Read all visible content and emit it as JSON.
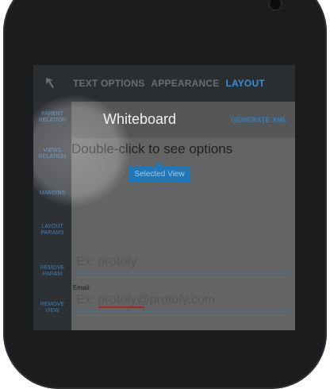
{
  "tabs": [
    {
      "label": "TEXT OPTIONS",
      "active": false
    },
    {
      "label": "APPEARANCE",
      "active": false
    },
    {
      "label": "LAYOUT",
      "active": true
    }
  ],
  "sidebar": {
    "items": [
      {
        "label": "PARENT RELATION"
      },
      {
        "label": "VIEWS RELATION"
      },
      {
        "label": "MARGINS"
      },
      {
        "label": "LAYOUT PARAMS"
      },
      {
        "label": "REMOVE PARAM"
      },
      {
        "label": "REMOVE VIEW"
      }
    ]
  },
  "header": {
    "title": "Whiteboard",
    "generate_xml": "GENERATE XML"
  },
  "canvas": {
    "hint": "Double-click to see options",
    "selected_view": "Selected View",
    "field1_placeholder": "Ex: protofy",
    "email_label": "Email:",
    "field2_placeholder": "Ex: protofy@protofy.com"
  },
  "icons": {
    "back": "cursor-arrow-icon"
  },
  "colors": {
    "accent": "#3a8fd0",
    "topbar": "#2b2e31",
    "sidebar": "#2d3034",
    "selected_view": "#2276b6"
  }
}
